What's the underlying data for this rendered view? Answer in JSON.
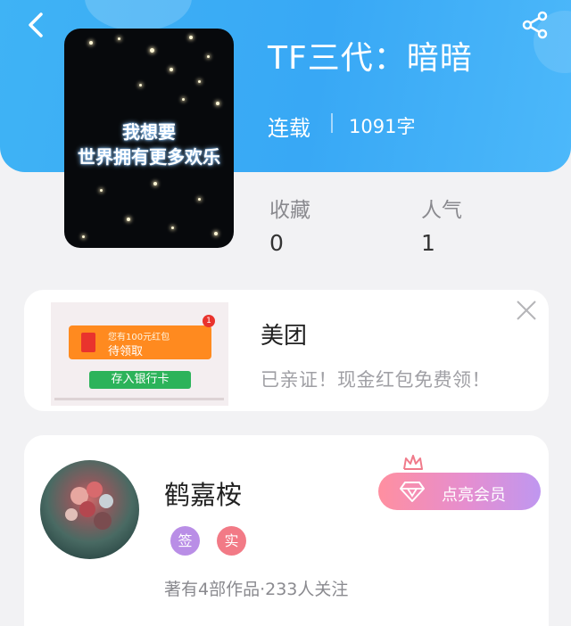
{
  "nav": {
    "back_icon": "chevron-left-icon",
    "share_icon": "share-icon"
  },
  "book": {
    "cover_text_line1": "我想要",
    "cover_text_line2": "世界拥有更多欢乐",
    "title": "TF三代：暗暗",
    "status": "连载",
    "word_count": "1091字",
    "stats": [
      {
        "label": "收藏",
        "value": "0"
      },
      {
        "label": "人气",
        "value": "1"
      }
    ]
  },
  "ad": {
    "thumb_banner_top": "您有100元红包",
    "thumb_banner_main": "待领取",
    "thumb_badge": "1",
    "thumb_button": "存入银行卡",
    "title": "美团",
    "description": "已亲证！现金红包免费领！",
    "close_icon": "close-icon"
  },
  "author": {
    "name": "鹤嘉桉",
    "badges": [
      {
        "label": "签",
        "color": "#b98ee6"
      },
      {
        "label": "实",
        "color": "#f27a86"
      }
    ],
    "summary": "著有4部作品·233人关注",
    "vip_button": "点亮会员",
    "vip_icons": [
      "crown-icon",
      "diamond-icon"
    ]
  },
  "colors": {
    "header_blue": "#3fb3f5",
    "vip_gradient_start": "#ff8fa0",
    "vip_gradient_end": "#bf97f0"
  }
}
